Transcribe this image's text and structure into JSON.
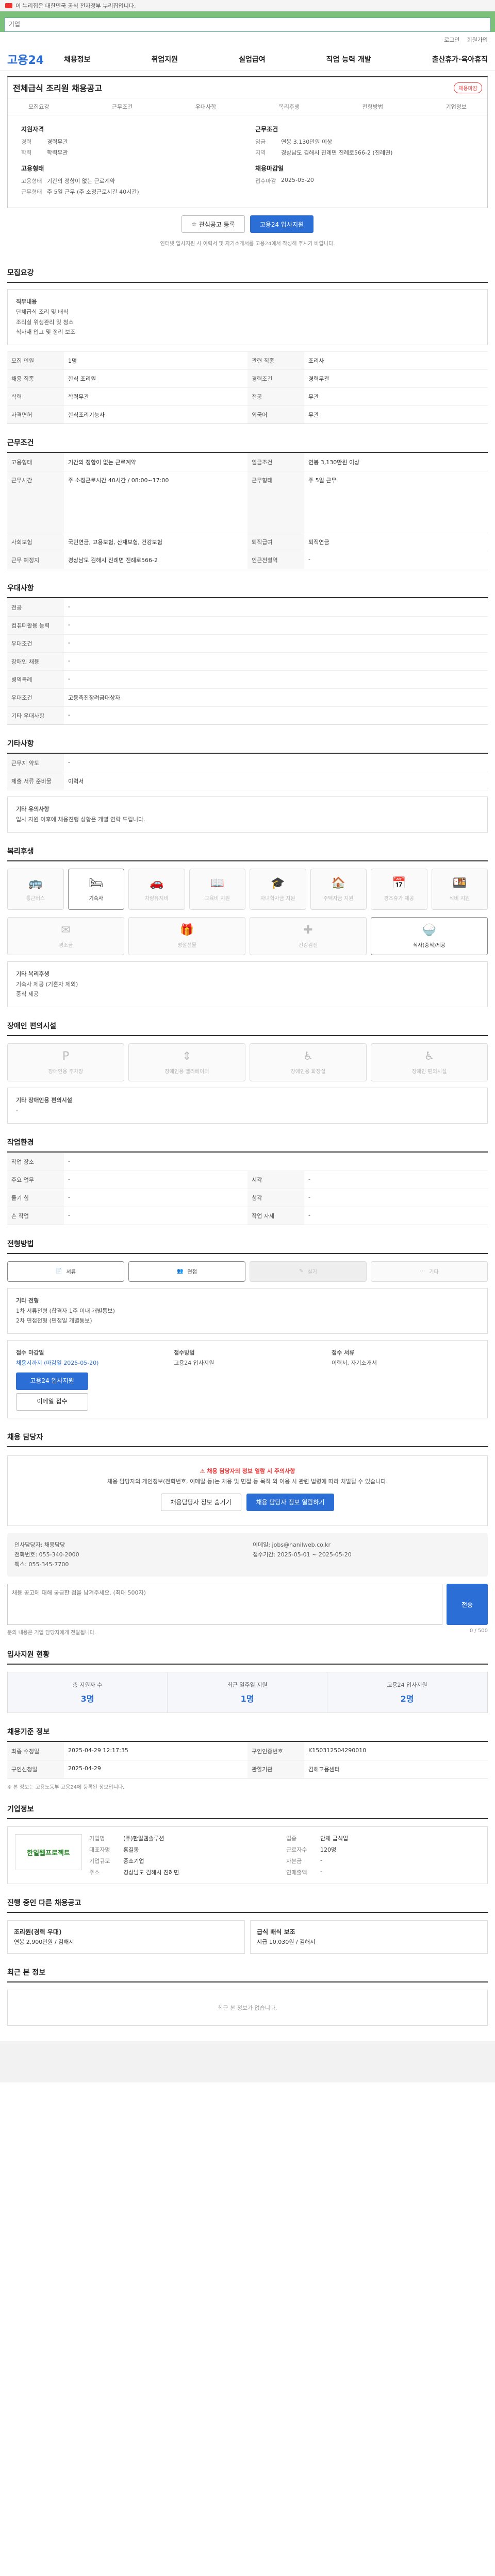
{
  "gov_bar": "이 누리집은 대한민국 공식 전자정부 누리집입니다.",
  "search": {
    "value": "기업"
  },
  "util": [
    "로그인",
    "회원가입"
  ],
  "logo": "고용24",
  "menu": [
    "채용정보",
    "취업지원",
    "실업급여",
    "직업 능력 개발",
    "출산휴가·육아휴직"
  ],
  "title": "전체급식 조리원 채용공고",
  "status_tag": "채용마감",
  "subnav": [
    "모집요강",
    "근무조건",
    "우대사항",
    "복리후생",
    "전형방법",
    "기업정보"
  ],
  "summary": {
    "left_title": "지원자격",
    "left": [
      {
        "k": "경력",
        "v": "경력무관"
      },
      {
        "k": "학력",
        "v": "학력무관"
      }
    ],
    "left_title2": "고용형태",
    "left2": [
      {
        "k": "고용형태",
        "v": "기간의 정함이 없는 근로계약"
      },
      {
        "k": "근무형태",
        "v": "주 5일 근무 (주 소정근로시간 40시간)"
      }
    ],
    "right_title": "근무조건",
    "right": [
      {
        "k": "임금",
        "v": "연봉 3,130만원 이상"
      },
      {
        "k": "지역",
        "v": "경상남도 김해시 진례면 진례로566-2 (진례면)"
      }
    ],
    "right_title2": "채용마감일",
    "right2": [
      {
        "k": "접수마감",
        "v": "2025-05-20"
      }
    ]
  },
  "buttons": {
    "scrap": "관심공고 등록",
    "apply": "고용24 입사지원"
  },
  "apply_note": "인터넷 입사지원 시 이력서 및 자기소개서를 고용24에서 작성해 주시기 바랍니다.",
  "sections": {
    "recruit": "모집요강",
    "work": "근무조건",
    "pref": "우대사항",
    "other": "기타사항",
    "welfare": "복리후생",
    "disability": "장애인 편의시설",
    "facility": "작업환경",
    "process": "전형방법",
    "contact": "채용 담당자",
    "stats": "입사지원 현황",
    "info": "채용기준 정보",
    "company": "기업정보",
    "others": "진행 중인 다른 채용공고",
    "recent": "최근 본 정보"
  },
  "recruit": {
    "duty_title": "직무내용",
    "duty": [
      "단체급식 조리 및 배식",
      "조리실 위생관리 및 청소",
      "식자재 입고 및 정리 보조"
    ],
    "rows": [
      {
        "k": "모집 인원",
        "v": "1명",
        "k2": "관련 직종",
        "v2": "조리사"
      },
      {
        "k": "채용 직종",
        "v": "한식 조리원",
        "k2": "경력조건",
        "v2": "경력무관"
      },
      {
        "k": "학력",
        "v": "학력무관",
        "k2": "전공",
        "v2": "무관"
      },
      {
        "k": "자격면허",
        "v": "한식조리기능사",
        "k2": "외국어",
        "v2": "무관"
      }
    ]
  },
  "work": {
    "rows": [
      {
        "k": "고용형태",
        "v": "기간의 정함이 없는 근로계약",
        "k2": "임금조건",
        "v2": "연봉 3,130만원 이상"
      },
      {
        "k": "근무시간",
        "v": "주 소정근로시간 40시간 / 08:00~17:00",
        "k2": "근무형태",
        "v2": "주 5일 근무"
      },
      {
        "k": "사회보험",
        "v": "국민연금, 고용보험, 산재보험, 건강보험",
        "k2": "퇴직급여",
        "v2": "퇴직연금"
      },
      {
        "k": "근무 예정지",
        "v": "경상남도 김해시 진례면 진례로566-2",
        "k2": "인근전철역",
        "v2": "-"
      }
    ]
  },
  "pref": {
    "rows": [
      {
        "k": "전공",
        "v": "-"
      },
      {
        "k": "컴퓨터활용 능력",
        "v": "-"
      },
      {
        "k": "우대조건",
        "v": "-"
      },
      {
        "k": "장애인 채용",
        "v": "-"
      },
      {
        "k": "병역특례",
        "v": "-"
      },
      {
        "k": "우대조건",
        "v": "고용촉진장려금대상자"
      },
      {
        "k": "기타 우대사항",
        "v": "-"
      }
    ]
  },
  "other": {
    "rows": [
      {
        "k": "근무지 약도",
        "v": "-"
      },
      {
        "k": "제출 서류 준비물",
        "v": "이력서"
      }
    ],
    "note_title": "기타 유의사항",
    "note": "입사 지원 이후에 채용진행 상황은 개별 연락 드립니다."
  },
  "welfare": {
    "icons": [
      "통근버스",
      "기숙사",
      "차량유지비",
      "교육비 지원",
      "자녀학자금 지원",
      "주택자금 지원",
      "경조휴가 제공",
      "식비 지원"
    ],
    "active": [
      1
    ],
    "icons2": [
      "경조금",
      "명절선물",
      "건강검진",
      "식사(중식)제공"
    ],
    "active2": [
      3
    ],
    "etc_title": "기타 복리후생",
    "etc": [
      "기숙사 제공 (기혼자 제외)",
      "중식 제공"
    ]
  },
  "disability": {
    "icons": [
      "장애인용 주차장",
      "장애인용 엘리베이터",
      "장애인용 화장실",
      "장애인 편의시설"
    ],
    "etc_title": "기타 장애인용 편의시설",
    "etc": "-"
  },
  "facility": {
    "rows": [
      {
        "k": "작업 장소",
        "v": "-",
        "k2": "",
        "v2": ""
      },
      {
        "k": "주요 업무",
        "v": "-",
        "k2": "시각",
        "v2": "-"
      },
      {
        "k": "들기 힘",
        "v": "-",
        "k2": "청각",
        "v2": "-"
      },
      {
        "k": "손 작업",
        "v": "-",
        "k2": "작업 자세",
        "v2": "-"
      }
    ]
  },
  "process": {
    "steps": [
      "서류",
      "면접",
      "실기",
      "기타"
    ],
    "active": [
      0,
      1
    ],
    "etc_title": "기타 전형",
    "etc": [
      "1차 서류전형 (합격자 1주 이내 개별통보)",
      "2차 면접전형 (면접일 개별통보)"
    ],
    "method_title": "접수 마감일",
    "method_val": "채용시까지 (마감일 2025-05-20)",
    "receipt_title": "접수방법",
    "receipt": "고용24 입사지원",
    "receipt2": "이메일 접수",
    "docs_title": "접수 서류",
    "docs": "이력서, 자기소개서"
  },
  "contact": {
    "c1": [
      "인사담당자: 채용담당",
      "전화번호: 055-340-2000",
      "팩스: 055-345-7700"
    ],
    "c2": [
      "이메일: jobs@hanilweb.co.kr",
      "접수기간: 2025-05-01 ~ 2025-05-20"
    ],
    "warn_a": "채용 담당자의 정보 열람 시 주의사항",
    "warn_b": "채용 담당자의 개인정보(전화번호, 이메일 등)는 채용 및 면접 등 목적 외 이용 시 관련 법령에 따라 처벌될 수 있습니다.",
    "warn_btn1": "채용담당자 정보 숨기기",
    "warn_btn2": "채용 담당자 정보 열람하기",
    "inquiry_placeholder": "채용 공고에 대해 궁금한 점을 남겨주세요. (최대 500자)",
    "inquiry_count": "0 / 500",
    "inquiry_btn": "전송",
    "inquiry_note": "문의 내용은 기업 담당자에게 전달됩니다."
  },
  "stats": [
    {
      "k": "총 지원자 수",
      "v": "3명"
    },
    {
      "k": "최근 일주일 지원",
      "v": "1명"
    },
    {
      "k": "고용24 입사지원",
      "v": "2명"
    }
  ],
  "info": {
    "rows": [
      {
        "k": "최종 수정일",
        "v": "2025-04-29 12:17:35",
        "k2": "구인인증번호",
        "v2": "K150312504290010"
      },
      {
        "k": "구인신청일",
        "v": "2025-04-29",
        "k2": "관할기관",
        "v2": "김해고용센터"
      }
    ],
    "note": "※ 본 정보는 고용노동부 고용24에 등록된 정보입니다."
  },
  "company": {
    "logo": "한일웹프로젝트",
    "rows": [
      {
        "k": "기업명",
        "v": "(주)한일웹솔루션",
        "k2": "업종",
        "v2": "단체 급식업"
      },
      {
        "k": "대표자명",
        "v": "홍길동",
        "k2": "근로자수",
        "v2": "120명"
      },
      {
        "k": "기업규모",
        "v": "중소기업",
        "k2": "자본금",
        "v2": "-"
      },
      {
        "k": "주소",
        "v": "경상남도 김해시 진례면",
        "k2": "연매출액",
        "v2": "-"
      }
    ]
  },
  "others": [
    {
      "title": "조리원(경력 우대)",
      "meta": "연봉 2,900만원 / 김해시"
    },
    {
      "title": "급식 배식 보조",
      "meta": "시급 10,030원 / 김해시"
    }
  ],
  "recent": "최근 본 정보가 없습니다."
}
